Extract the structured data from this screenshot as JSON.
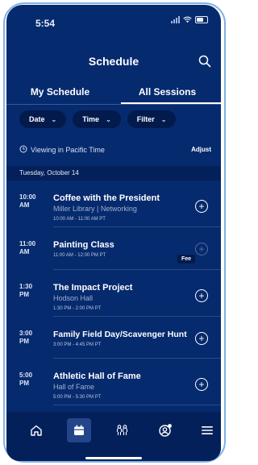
{
  "status_bar": {
    "time": "5:54"
  },
  "header": {
    "title": "Schedule"
  },
  "tabs": [
    {
      "label": "My Schedule",
      "active": false
    },
    {
      "label": "All Sessions",
      "active": true
    }
  ],
  "filters": [
    {
      "label": "Date"
    },
    {
      "label": "Time"
    },
    {
      "label": "Filter"
    }
  ],
  "timezone": {
    "text": "Viewing in Pacific Time",
    "adjust_label": "Adjust"
  },
  "date_header": "Tuesday, October 14",
  "sessions": [
    {
      "start": "10:00 AM",
      "title": "Coffee with the President",
      "location": "Miller Library | Networking",
      "time_range": "10:00 AM - 11:00 AM PT",
      "badge": "",
      "add_enabled": true
    },
    {
      "start": "11:00 AM",
      "title": "Painting Class",
      "location": "",
      "time_range": "11:00 AM - 12:00 PM PT",
      "badge": "Fee",
      "add_enabled": false
    },
    {
      "start": "1:30 PM",
      "title": "The Impact Project",
      "location": "Hodson Hall",
      "time_range": "1:30 PM - 2:00 PM PT",
      "badge": "",
      "add_enabled": true
    },
    {
      "start": "3:00 PM",
      "title": "Family Field Day/Scavenger Hunt",
      "location": "",
      "time_range": "3:00 PM - 4:45 PM PT",
      "badge": "",
      "add_enabled": true
    },
    {
      "start": "5:00 PM",
      "title": "Athletic Hall of Fame",
      "location": "Hall of Fame",
      "time_range": "5:00 PM - 5:30 PM PT",
      "badge": "",
      "add_enabled": true
    }
  ],
  "bottom_nav": [
    {
      "icon": "home-icon",
      "active": false
    },
    {
      "icon": "calendar-icon",
      "active": true
    },
    {
      "icon": "people-icon",
      "active": false
    },
    {
      "icon": "profile-icon",
      "active": false
    },
    {
      "icon": "menu-icon",
      "active": false
    }
  ],
  "colors": {
    "background": "#062a6e",
    "nav_background": "#04205a",
    "chip_background": "#031a4c",
    "accent_frame": "#7fb2e5"
  }
}
